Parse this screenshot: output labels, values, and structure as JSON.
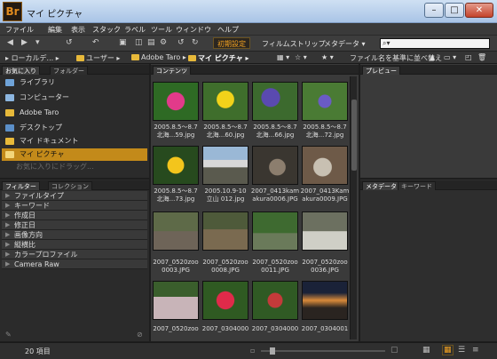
{
  "window": {
    "title": "マイ ピクチャ",
    "logo": "Br"
  },
  "menu": [
    "ファイル",
    "編集",
    "表示",
    "スタック",
    "ラベル",
    "ツール",
    "ウィンドウ",
    "ヘルプ"
  ],
  "toolbar": {
    "workspaces": [
      "初期設定",
      "フィルムストリップ",
      "メタデータ ▾"
    ],
    "search_placeholder": ""
  },
  "path": {
    "items": [
      "ローカルデ...",
      "ユーザー",
      "Adobe Taro",
      "マイ ピクチャ"
    ],
    "sort_label": "ファイル名を基準に並べ替え"
  },
  "left_top": {
    "tabs": [
      "お気に入り",
      "フォルダー"
    ],
    "items": [
      "ライブラリ",
      "コンピューター",
      "Adobe Taro",
      "デスクトップ",
      "マイ ドキュメント",
      "マイ ピクチャ"
    ],
    "hint": "お気に入りにドラッグ..."
  },
  "left_bottom": {
    "tabs": [
      "フィルター",
      "コレクション"
    ],
    "items": [
      "ファイルタイプ",
      "キーワード",
      "作成日",
      "修正日",
      "画像方向",
      "縦横比",
      "カラープロファイル",
      "Camera Raw"
    ]
  },
  "content": {
    "tab": "コンテンツ",
    "items": [
      {
        "line1": "2005.8.5～8.7",
        "line2": "北海...59.jpg"
      },
      {
        "line1": "2005.8.5～8.7",
        "line2": "北海...60.jpg"
      },
      {
        "line1": "2005.8.5～8.7",
        "line2": "北海...66.jpg"
      },
      {
        "line1": "2005.8.5～8.7",
        "line2": "北海...72.jpg"
      },
      {
        "line1": "2005.8.5～8.7",
        "line2": "北海...73.jpg"
      },
      {
        "line1": "2005.10.9-10",
        "line2": "立山 012.jpg"
      },
      {
        "line1": "2007_0413kam",
        "line2": "akura0006.JPG"
      },
      {
        "line1": "2007_0413Kam",
        "line2": "akura0009.JPG"
      },
      {
        "line1": "2007_0520zoo",
        "line2": "0003.JPG"
      },
      {
        "line1": "2007_0520zoo",
        "line2": "0008.JPG"
      },
      {
        "line1": "2007_0520zoo",
        "line2": "0011.JPG"
      },
      {
        "line1": "2007_0520zoo",
        "line2": "0036.JPG"
      },
      {
        "line1": "2007_0520zoo",
        "line2": ""
      },
      {
        "line1": "2007_0304000",
        "line2": ""
      },
      {
        "line1": "2007_0304000",
        "line2": ""
      },
      {
        "line1": "2007_0304001",
        "line2": ""
      }
    ]
  },
  "right_top": {
    "tab": "プレビュー"
  },
  "right_bottom": {
    "tabs": [
      "メタデータ",
      "キーワード"
    ]
  },
  "status": {
    "count": "20 項目"
  }
}
